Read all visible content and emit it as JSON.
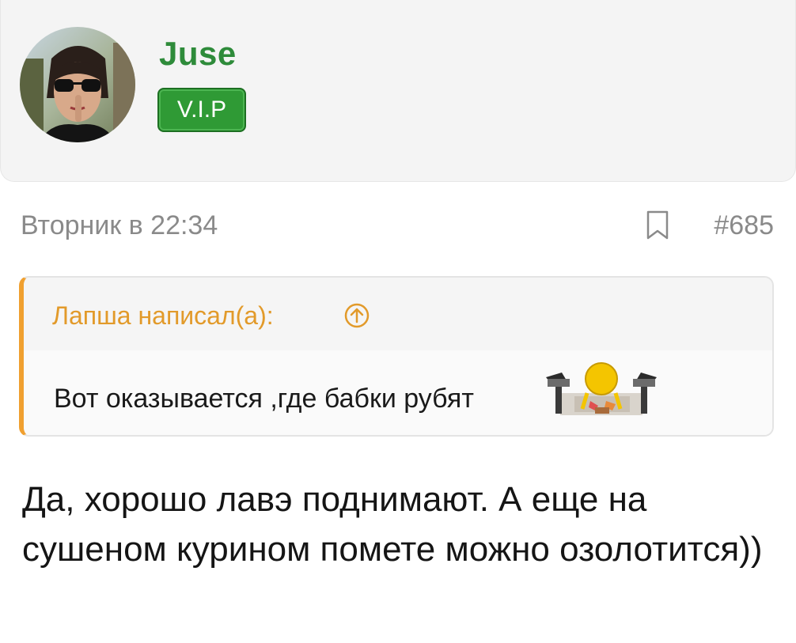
{
  "user": {
    "name": "Juse",
    "badge": "V.I.P"
  },
  "post": {
    "timestamp": "Вторник в 22:34",
    "number": "#685",
    "quote": {
      "author": "Лапша написал(а):",
      "text": "Вот оказывается ,где бабки рубят"
    },
    "body": "Да, хорошо лавэ поднимают. А еще на сушеном курином помете можно озолотится))"
  },
  "colors": {
    "username": "#2e8b3a",
    "badge_bg": "#2f9a35",
    "quote_accent": "#f0a030",
    "meta_text": "#8a8a8a"
  },
  "icons": {
    "bookmark": "bookmark-icon",
    "quote_link": "arrow-up-circle-icon",
    "emoji": "money-chopping-smiley-icon"
  }
}
